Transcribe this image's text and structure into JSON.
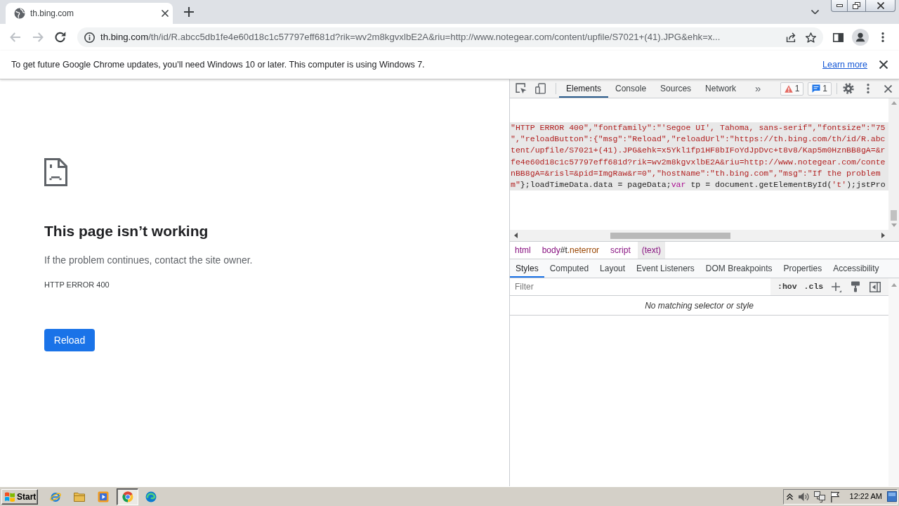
{
  "browser_tabs": [
    {
      "title": "th.bing.com",
      "selected": true
    }
  ],
  "nav_buttons": [
    {
      "kind": "back",
      "disabled": true
    },
    {
      "kind": "forward",
      "disabled": true
    },
    {
      "kind": "reload",
      "disabled": false
    }
  ],
  "address_bar": {
    "host": "th.bing.com",
    "path": "/th/id/R.abcc5db1fe4e60d18c1c57797eff681d?rik=wv2m8kgvxlbE2A&riu=http://www.notegear.com/content/upfile/S7021+(41).JPG&ehk=x..."
  },
  "infobar": {
    "message": "To get future Google Chrome updates, you'll need Windows 10 or later. This computer is using Windows 7.",
    "link": "Learn more"
  },
  "error_page": {
    "heading": "This page isn’t working",
    "message": "If the problem continues, contact the site owner.",
    "error_code": "HTTP ERROR 400",
    "button": "Reload"
  },
  "devtools": {
    "tabs": [
      {
        "label": "Elements",
        "selected": true
      },
      {
        "label": "Console",
        "selected": false
      },
      {
        "label": "Sources",
        "selected": false
      },
      {
        "label": "Network",
        "selected": false
      }
    ],
    "more_tabs": "»",
    "warning_count": "1",
    "message_count": "1",
    "code": {
      "selected": true,
      "lines": [
        [
          {
            "text": "\"HTTP ERROR 400\",\"fontfamily\":\"'Segoe UI', Tahoma, sans-serif\",\"fontsize\":\"75",
            "kind": "string"
          }
        ],
        [
          {
            "text": "\",\"reloadButton\":{\"msg\":\"Reload\",\"reloadUrl\":\"https://th.bing.com/th/id/R.abc",
            "kind": "string"
          }
        ],
        [
          {
            "text": "tent/upfile/S7021+(41).JPG&ehk=x5Ykl1fp1HF8bIFoYdJpDvc+t8v8/Kap5m0HznBB8gA=&r",
            "kind": "string"
          }
        ],
        [
          {
            "text": "fe4e60d18c1c57797eff681d?rik=wv2m8kgvxlbE2A&riu=http://www.notegear.com/conte",
            "kind": "string"
          }
        ],
        [
          {
            "text": "nBB8gA=&risl=&pid=ImgRaw&r=0\",\"hostName\":\"th.bing.com\",\"msg\":\"If the problem",
            "kind": "string"
          }
        ],
        [
          {
            "text": "m\"",
            "kind": "string"
          },
          {
            "text": "};loadTimeData.data = pageData;",
            "kind": "plain"
          },
          {
            "text": "var",
            "kind": "keyword"
          },
          {
            "text": " tp = document.getElementById(",
            "kind": "plain"
          },
          {
            "text": "'t'",
            "kind": "string"
          },
          {
            "text": ");jstPro",
            "kind": "plain"
          }
        ]
      ]
    },
    "breadcrumbs": [
      {
        "selected": false,
        "tokens": [
          {
            "text": "html",
            "kind": "tag"
          }
        ]
      },
      {
        "selected": false,
        "tokens": [
          {
            "text": "body",
            "kind": "tag"
          },
          {
            "text": "#t",
            "kind": "id"
          },
          {
            "text": ".neterror",
            "kind": "class"
          }
        ]
      },
      {
        "selected": false,
        "tokens": [
          {
            "text": "script",
            "kind": "tag"
          }
        ]
      },
      {
        "selected": true,
        "tokens": [
          {
            "text": "(text)",
            "kind": "tag"
          }
        ]
      }
    ],
    "pane_tabs": [
      {
        "label": "Styles",
        "selected": true
      },
      {
        "label": "Computed",
        "selected": false
      },
      {
        "label": "Layout",
        "selected": false
      },
      {
        "label": "Event Listeners",
        "selected": false
      },
      {
        "label": "DOM Breakpoints",
        "selected": false
      },
      {
        "label": "Properties",
        "selected": false
      },
      {
        "label": "Accessibility",
        "selected": false
      }
    ],
    "filter": {
      "placeholder": "Filter"
    },
    "pane_toggles": [
      ":hov",
      ".cls"
    ],
    "empty_message": "No matching selector or style"
  },
  "taskbar": {
    "start": "Start",
    "apps": [
      {
        "kind": "ie",
        "active": false
      },
      {
        "kind": "explorer",
        "active": false
      },
      {
        "kind": "media",
        "active": false
      },
      {
        "kind": "chrome",
        "active": true
      },
      {
        "kind": "edge",
        "active": false
      }
    ],
    "tray": [
      {
        "kind": "chevron"
      },
      {
        "kind": "volume"
      },
      {
        "kind": "network"
      },
      {
        "kind": "flag"
      }
    ],
    "clock": "12:22 AM"
  }
}
